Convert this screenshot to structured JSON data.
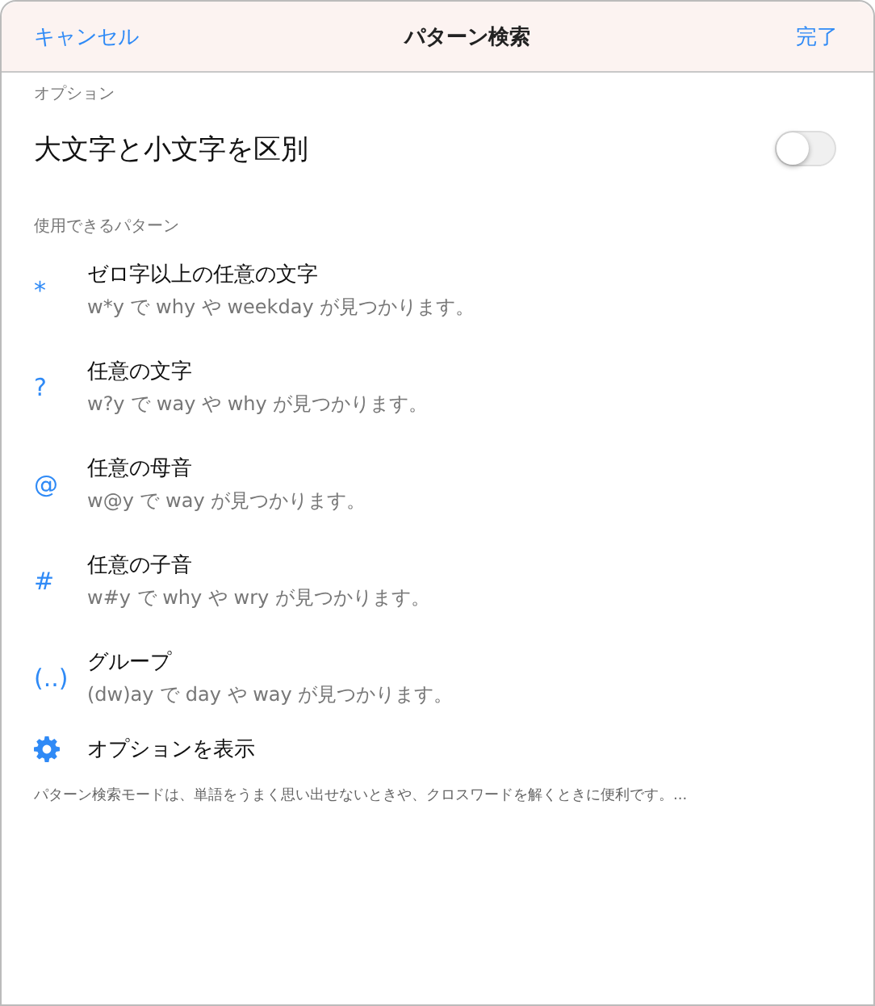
{
  "nav": {
    "cancel": "キャンセル",
    "title": "パターン検索",
    "done": "完了"
  },
  "options": {
    "header": "オプション",
    "toggle": {
      "label": "大文字と小文字を区別",
      "on": false
    }
  },
  "patterns": {
    "header": "使用できるパターン",
    "items": [
      {
        "symbol": "*",
        "title": "ゼロ字以上の任意の文字",
        "example": "w*y で why や weekday が見つかります。"
      },
      {
        "symbol": "?",
        "title": "任意の文字",
        "example": "w?y で way や why が見つかります。"
      },
      {
        "symbol": "@",
        "title": "任意の母音",
        "example": "w@y で way が見つかります。"
      },
      {
        "symbol": "#",
        "title": "任意の子音",
        "example": "w#y で why や wry が見つかります。"
      },
      {
        "symbol": "(..)",
        "title": "グループ",
        "example": "(dw)ay で day や way が見つかります。"
      }
    ]
  },
  "show_options": "オプションを表示",
  "footer": "パターン検索モードは、単語をうまく思い出せないときや、クロスワードを解くときに便利です。..."
}
